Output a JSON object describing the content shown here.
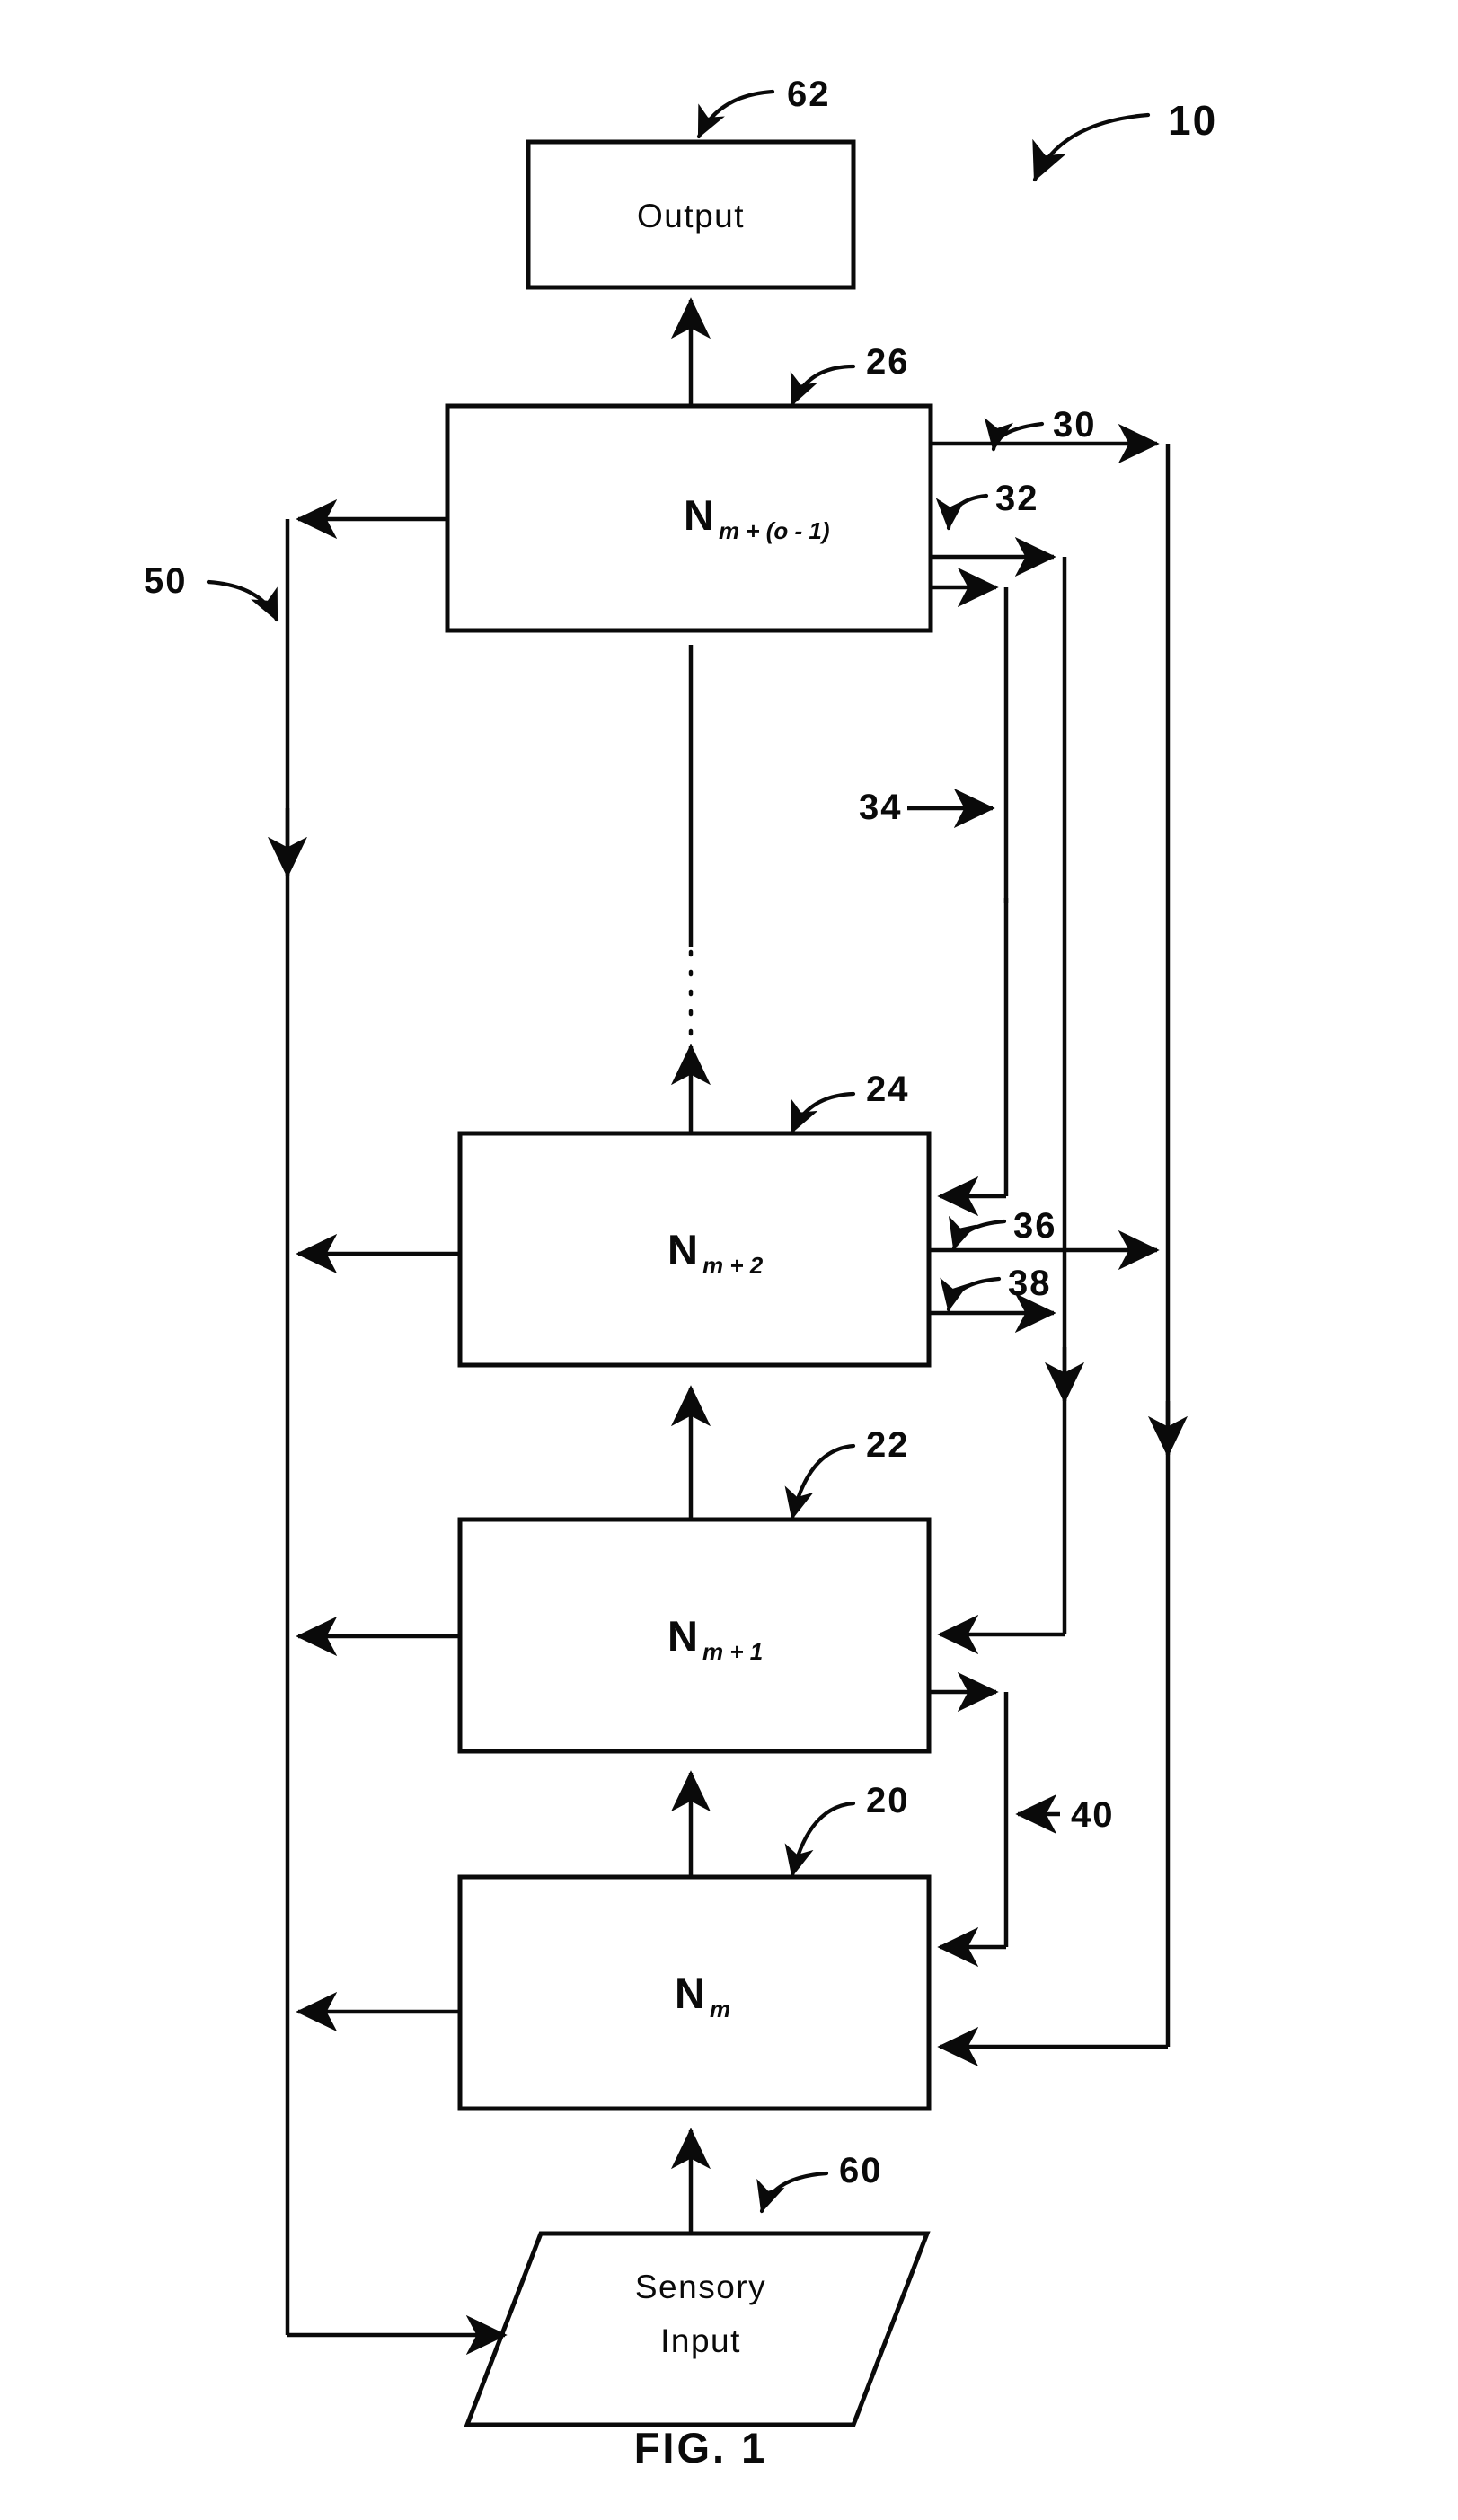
{
  "figure": {
    "caption": "FIG. 1",
    "overall_ref": "10"
  },
  "blocks": [
    {
      "id": "output",
      "label": "Output",
      "ref": "62",
      "shape": "rectangle"
    },
    {
      "id": "layer-top",
      "label_main": "N",
      "label_sub": "m + (o - 1)",
      "ref": "26",
      "shape": "rectangle"
    },
    {
      "id": "layer-mplus2",
      "label_main": "N",
      "label_sub": "m + 2",
      "ref": "24",
      "shape": "rectangle"
    },
    {
      "id": "layer-mplus1",
      "label_main": "N",
      "label_sub": "m + 1",
      "ref": "22",
      "shape": "rectangle"
    },
    {
      "id": "layer-m",
      "label_main": "N",
      "label_sub": "m",
      "ref": "20",
      "shape": "rectangle"
    },
    {
      "id": "sensory-input",
      "label_line1": "Sensory",
      "label_line2": "Input",
      "ref": "60",
      "shape": "parallelogram"
    }
  ],
  "connector_refs": [
    {
      "id": "ref-30",
      "label": "30"
    },
    {
      "id": "ref-32",
      "label": "32"
    },
    {
      "id": "ref-34",
      "label": "34"
    },
    {
      "id": "ref-36",
      "label": "36"
    },
    {
      "id": "ref-38",
      "label": "38"
    },
    {
      "id": "ref-40",
      "label": "40"
    },
    {
      "id": "ref-50",
      "label": "50"
    }
  ],
  "colors": {
    "ink": "#0a0a0a",
    "background": "#ffffff"
  }
}
